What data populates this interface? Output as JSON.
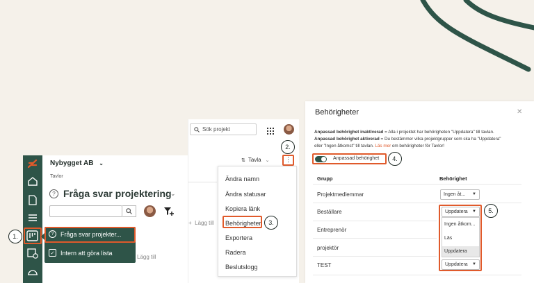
{
  "colors": {
    "brand_green": "#2e5448",
    "highlight_orange": "#e05a2b",
    "background": "#f5f1ea"
  },
  "panel_left": {
    "company": "Nybygget AB",
    "breadcrumb": "Tavlor",
    "board_title": "Fråga svar projektering",
    "active_item_label": "Fråga svar projekter...",
    "second_item_label": "Intern att göra lista",
    "add_label": "Lägg till",
    "step": "1."
  },
  "panel_middle": {
    "search_placeholder": "Sök projekt",
    "view_label": "Tavla",
    "add_label": "Lägg till",
    "step_dots": "2.",
    "step_menu": "3.",
    "menu_items": [
      "Ändra namn",
      "Ändra statusar",
      "Kopiera länk",
      "Behörigheter",
      "Exportera",
      "Radera",
      "Beslutslogg"
    ]
  },
  "panel_right": {
    "title": "Behörigheter",
    "desc_bold1": "Anpassad behörighet inaktiverad",
    "desc_text1": " = Alla i projektet har behörigheten \"Uppdatera\" till tavlan.",
    "desc_bold2": "Anpassad behörighet aktiverad",
    "desc_text2": " = Du bestämmer vilka projektgrupper som ska ha \"Uppdatera\"",
    "desc_text3": "eller \"Ingen åtkomst\" till tavlan. ",
    "desc_link": "Läs mer",
    "desc_text4": " om behörigheter för Tavlor!",
    "toggle_label": "Anpassad behörighet",
    "step_toggle": "4.",
    "step_dropdown": "5.",
    "col_group": "Grupp",
    "col_perm": "Behörighet",
    "rows": [
      {
        "group": "Projektmedlemmar",
        "perm": "Ingen åt..."
      },
      {
        "group": "Beställare",
        "perm": "Uppdatera"
      },
      {
        "group": "Entreprenör",
        "perm": ""
      },
      {
        "group": "projektör",
        "perm": ""
      },
      {
        "group": "TEST",
        "perm": "Uppdatera"
      }
    ],
    "dropdown_options": [
      "Ingen åtkom...",
      "Läs",
      "Uppdatera"
    ]
  }
}
